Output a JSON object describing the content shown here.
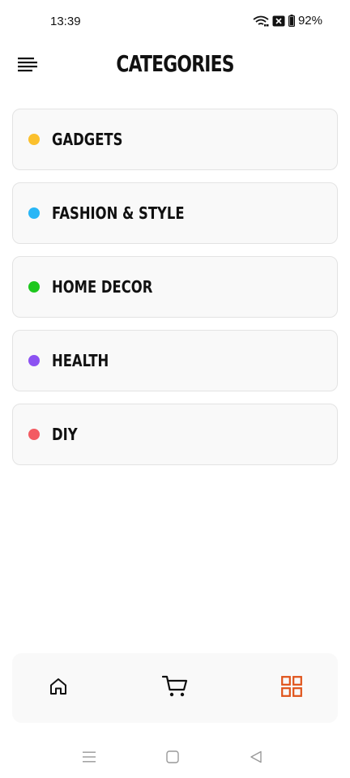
{
  "status_bar": {
    "time": "13:39",
    "battery": "92%",
    "icons": [
      "wifi-icon",
      "sim-off-icon",
      "battery-icon"
    ]
  },
  "header": {
    "title": "CATEGORIES",
    "menu_icon": "hamburger-menu-icon"
  },
  "categories": [
    {
      "label": "GADGETS",
      "color": "#fbc02d"
    },
    {
      "label": "FASHION & STYLE",
      "color": "#29b6f6"
    },
    {
      "label": "HOME DECOR",
      "color": "#1ec71e"
    },
    {
      "label": "HEALTH",
      "color": "#8c52f2"
    },
    {
      "label": "DIY",
      "color": "#f35b62"
    }
  ],
  "bottom_nav": {
    "items": [
      {
        "icon": "home-icon",
        "active": false
      },
      {
        "icon": "cart-icon",
        "active": false
      },
      {
        "icon": "categories-grid-icon",
        "active": true
      }
    ],
    "active_color": "#e0531a"
  },
  "system_nav": [
    "recents-icon",
    "home-square-icon",
    "back-triangle-icon"
  ]
}
